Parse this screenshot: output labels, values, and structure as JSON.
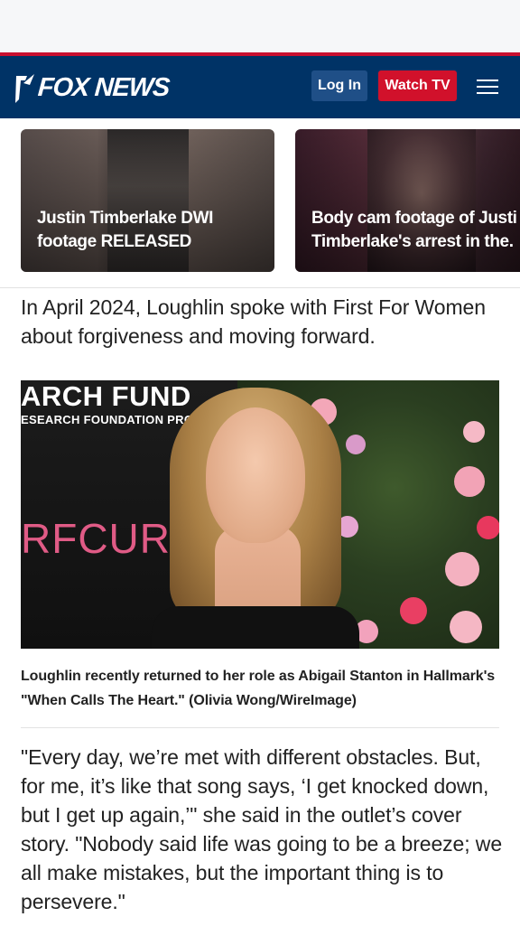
{
  "header": {
    "logo_text": "FOX NEWS",
    "login_label": "Log In",
    "watch_label": "Watch TV",
    "colors": {
      "navy": "#003366",
      "red": "#d1112b",
      "login_blue": "#1f4f87"
    }
  },
  "video_cards": [
    {
      "title": "Justin Timberlake DWI footage RELEASED"
    },
    {
      "title": "Body cam footage of Justin Timberlake's arrest in the..."
    }
  ],
  "card_titles_lines": [
    [
      "Justin Timberlake DWI",
      "footage RELEASED"
    ],
    [
      "Body cam footage of Justi",
      "Timberlake's arrest in the."
    ]
  ],
  "article": {
    "paragraph_1": "In April 2024, Loughlin spoke with First For Women about forgiveness and moving forward.",
    "photo": {
      "backdrop_text_1": "ARCH FUND",
      "backdrop_text_2": "ESEARCH FOUNDATION PROGRAM",
      "backdrop_text_3": "RFCURE"
    },
    "caption": "Loughlin recently returned to her role as Abigail Stanton in Hallmark's \"When Calls The Heart.\" (Olivia Wong/WireImage)",
    "paragraph_2": "\"Every day, we’re met with different obstacles. But, for me, it’s like that song says, ‘I get knocked down, but I get up again,’\" she said in the outlet’s cover story. \"Nobody said life was going to be a breeze; we all make mistakes, but the important thing is to persevere.\""
  },
  "icons": {
    "menu": "hamburger-menu-icon",
    "logo": "fox-news-logo"
  }
}
